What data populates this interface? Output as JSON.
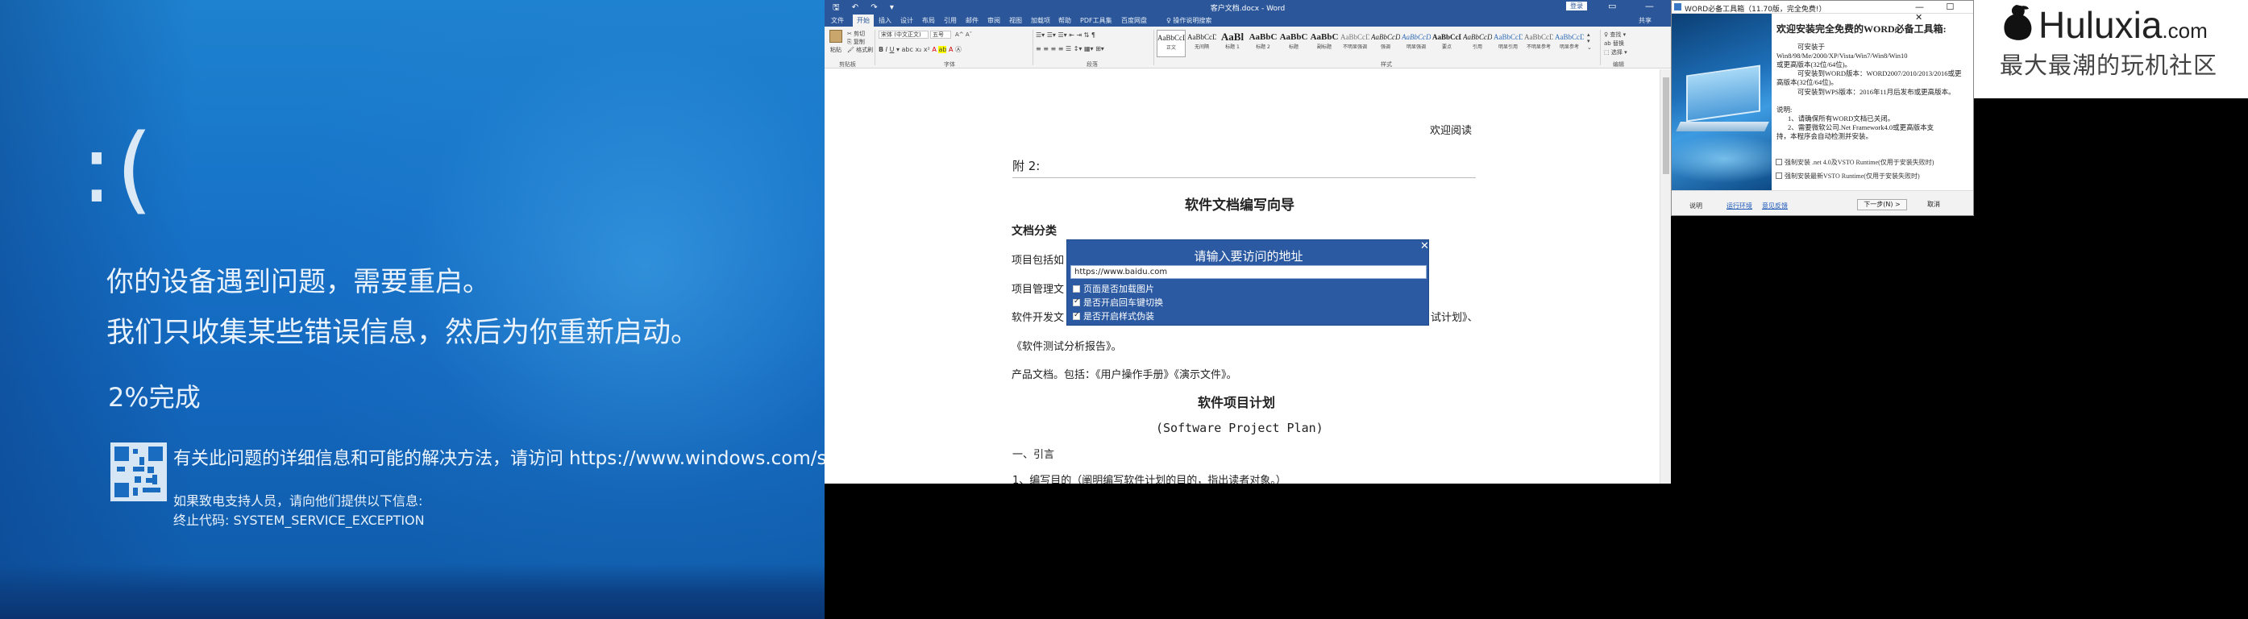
{
  "bsod": {
    "face": ":(",
    "line1": "你的设备遇到问题，需要重启。",
    "line2": "我们只收集某些错误信息，然后为你重新启动。",
    "progress": "2%完成",
    "info_prefix": "有关此问题的详细信息和可能的解决方法，请访问 ",
    "info_url": "https://www.windows.com/stopcode",
    "support": "如果致电支持人员，请向他们提供以下信息:",
    "stop_code": "终止代码: SYSTEM_SERVICE_EXCEPTION"
  },
  "word": {
    "title": "客户文档.docx - Word",
    "qat": "🖫 ↶ ↷ ▾",
    "signin": "登录",
    "window_controls": "▭ — ☐ ✕",
    "tabs": [
      "文件",
      "开始",
      "插入",
      "设计",
      "布局",
      "引用",
      "邮件",
      "审阅",
      "视图",
      "加载项",
      "帮助",
      "PDF工具集",
      "百度网盘"
    ],
    "active_tab": "开始",
    "tell_me": "♀ 操作说明搜索",
    "share": "共享",
    "ribbon": {
      "paste": "粘贴",
      "cut": "✂ 剪切",
      "copy": "⎘ 复制",
      "format_painter": "🖌 格式刷",
      "font_name": "宋体 (中文正文)",
      "font_size": "五号",
      "groups": [
        "剪贴板",
        "字体",
        "段落",
        "样式",
        "编辑"
      ],
      "styles": [
        {
          "preview": "AaBbCcDd",
          "name": "正文"
        },
        {
          "preview": "AaBbCcDd",
          "name": "无间隔"
        },
        {
          "preview": "AaBl",
          "name": "标题 1"
        },
        {
          "preview": "AaBbC",
          "name": "标题 2"
        },
        {
          "preview": "AaBbC",
          "name": "标题"
        },
        {
          "preview": "AaBbC",
          "name": "副标题"
        },
        {
          "preview": "AaBbCcDd",
          "name": "不明显强调"
        },
        {
          "preview": "AaBbCcDd",
          "name": "强调"
        },
        {
          "preview": "AaBbCcDd",
          "name": "明显强调"
        },
        {
          "preview": "AaBbCcDd",
          "name": "要点"
        },
        {
          "preview": "AaBbCcDd",
          "name": "引用"
        },
        {
          "preview": "AaBbCcDd",
          "name": "明显引用"
        },
        {
          "preview": "AaBbCcDd",
          "name": "不明显参考"
        },
        {
          "preview": "AaBbCcDd",
          "name": "明显参考"
        }
      ],
      "find": "♀ 查找 ▾",
      "replace": "ab 替换",
      "select": "⬚ 选择 ▾"
    },
    "doc": {
      "header_right": "欢迎阅读",
      "appendix": "附 2:",
      "main_title": "软件文档编写向导",
      "section_title": "文档分类",
      "line_project": "项目包括如",
      "line_manage": "项目管理文",
      "line_dev": "软件开发文",
      "line_dev_tail": "试计划》、",
      "line_test": "《软件测试分析报告》。",
      "line_product": "产品文档。包括：《用户操作手册》《演示文件》。",
      "plan_title": "软件项目计划",
      "plan_en": "(Software Project Plan)",
      "sec1": "一、引言",
      "sec1_1": "1、编写目的（阐明编写软件计划的目的，指出读者对象。）"
    },
    "url_dialog": {
      "title": "请输入要访问的地址",
      "url_value": "https://www.baidu.com",
      "options": [
        {
          "label": "页面是否加载图片",
          "checked": false
        },
        {
          "label": "是否开启回车键切换",
          "checked": true
        },
        {
          "label": "是否开启样式伪装",
          "checked": true
        }
      ],
      "close": "✕"
    }
  },
  "installer": {
    "title": "WORD必备工具箱（11.70版，完全免费!）",
    "window_controls": "— ☐ ✕",
    "heading": "欢迎安装完全免费的WORD必备工具箱:",
    "lines": [
      "可安装于",
      "Win8/98/Me/2000/XP/Vista/Win7/Win8/Win10",
      "或更高版本(32位/64位)。",
      "可安装到WORD版本：WORD2007/2010/2013/2016或更",
      "高版本(32位/64位)。",
      "可安装到WPS版本：2016年11月后发布或更高版本。",
      "说明:",
      "1、请确保所有WORD文档已关闭。",
      "2、需要微软公司.Net Framework4.0或更高版本支",
      "持，本程序会自动检测并安装。"
    ],
    "options": [
      "强制安装 .net 4.0及VSTO Runtime(仅用于安装失败时)",
      "强制安装最新VSTO Runtime(仅用于安装失败时)"
    ],
    "buttons": {
      "help": "说明",
      "run_env": "运行环境",
      "feedback": "意见反馈",
      "next": "下一步(N) >",
      "cancel": "取消"
    }
  },
  "watermark": {
    "brand": "Huluxia",
    "brand_suffix": ".com",
    "slogan": "最大最潮的玩机社区"
  },
  "colors": {
    "bsod_blue": "#1773c8",
    "word_blue": "#2b579a",
    "dialog_blue": "#2b5aa2"
  }
}
